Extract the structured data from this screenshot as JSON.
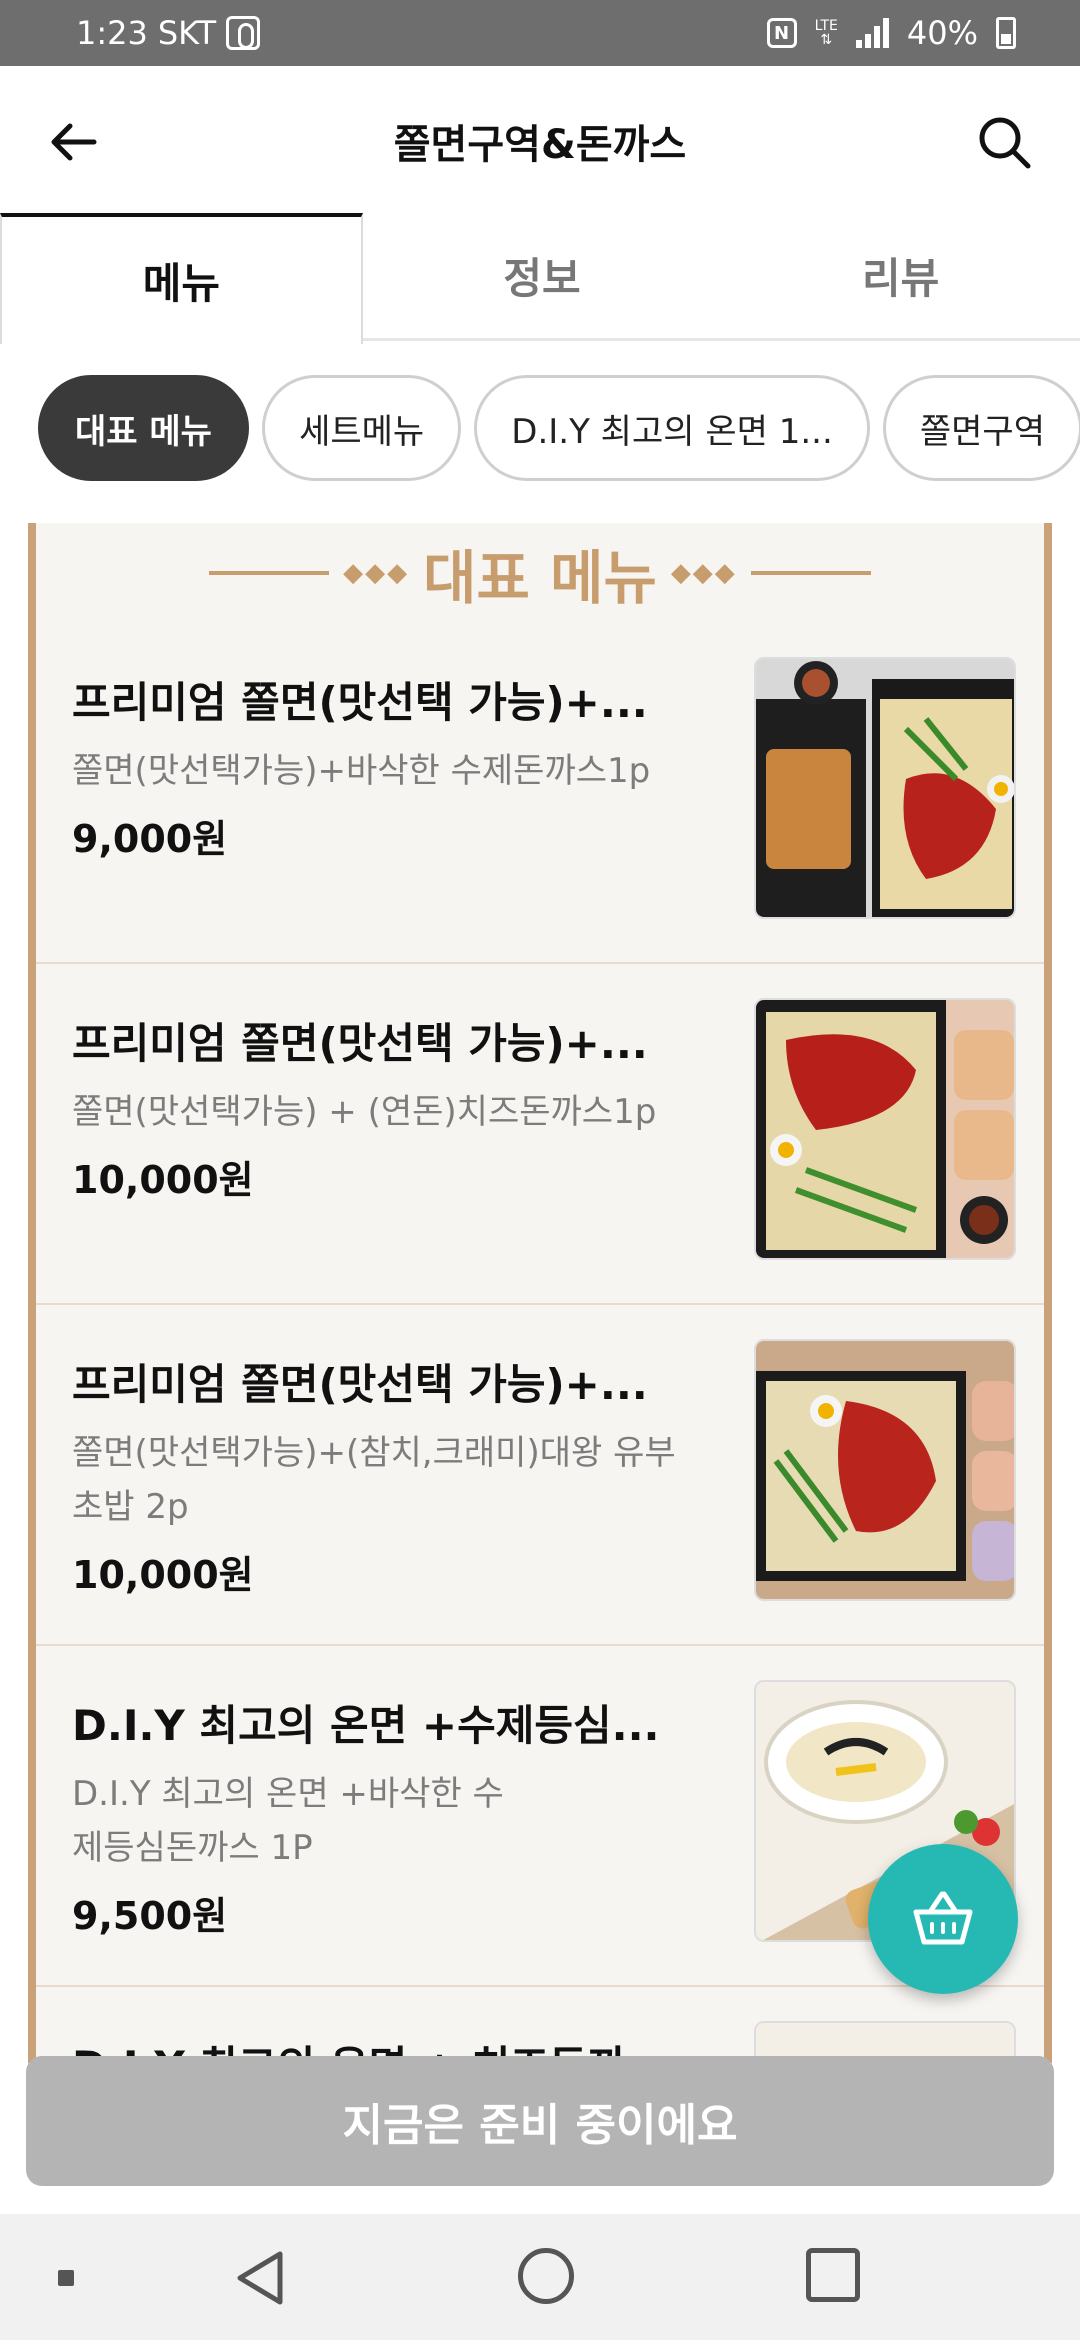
{
  "status_bar": {
    "time": "1:23",
    "carrier": "SKT",
    "network": "LTE",
    "battery": "40%"
  },
  "header": {
    "title": "쫄면구역&돈까스"
  },
  "tabs": [
    {
      "label": "메뉴",
      "active": true
    },
    {
      "label": "정보",
      "active": false
    },
    {
      "label": "리뷰",
      "active": false
    }
  ],
  "chips": [
    {
      "label": "대표 메뉴",
      "active": true
    },
    {
      "label": "세트메뉴",
      "active": false
    },
    {
      "label": "D.I.Y 최고의 온면 1...",
      "active": false
    },
    {
      "label": "쫄면구역",
      "active": false
    }
  ],
  "section": {
    "title": "대표 메뉴"
  },
  "menu_items": [
    {
      "name": "프리미엄 쫄면(맛선택 가능)+...",
      "desc": "쫄면(맛선택가능)+바삭한 수제돈까스1p",
      "price": "9,000원"
    },
    {
      "name": "프리미엄 쫄면(맛선택 가능)+...",
      "desc": "쫄면(맛선택가능) + (연돈)치즈돈까스1p",
      "price": "10,000원"
    },
    {
      "name": "프리미엄 쫄면(맛선택 가능)+...",
      "desc": "쫄면(맛선택가능)+(참치,크래미)대왕 유부초밥 2p",
      "price": "10,000원"
    },
    {
      "name": "D.I.Y 최고의 온면 +수제등심...",
      "desc": "D.I.Y 최고의 온면 +바삭한 수제등심돈까스 1P",
      "price": "9,500원"
    },
    {
      "name": "D.I.Y 최고의 온면 + 치즈돈까",
      "desc": "",
      "price": ""
    }
  ],
  "bottom_button": {
    "label": "지금은 준비 중이에요"
  },
  "colors": {
    "accent": "#26b9b4",
    "section_gold": "#c89d6e",
    "active_chip": "#3a3a3a",
    "disabled_button": "#b4b4b4"
  }
}
